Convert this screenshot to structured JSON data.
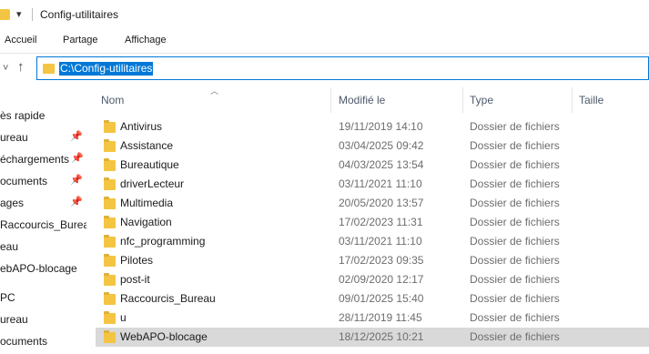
{
  "window": {
    "title": "Config-utilitaires"
  },
  "ribbon": {
    "tabs": [
      "Accueil",
      "Partage",
      "Affichage"
    ]
  },
  "address": {
    "path": "C:\\Config-utilitaires"
  },
  "sidebar": {
    "items": [
      {
        "label": "ès rapide",
        "pinned": false
      },
      {
        "label": "ureau",
        "pinned": true
      },
      {
        "label": "échargements",
        "pinned": true
      },
      {
        "label": "ocuments",
        "pinned": true
      },
      {
        "label": "ages",
        "pinned": true
      },
      {
        "label": "Raccourcis_Bureau",
        "pinned": false
      },
      {
        "label": "eau",
        "pinned": false
      },
      {
        "label": "ebAPO-blocage",
        "pinned": false
      },
      {
        "label": "PC",
        "pinned": false
      },
      {
        "label": "ureau",
        "pinned": false
      },
      {
        "label": "ocuments",
        "pinned": false
      }
    ]
  },
  "columns": {
    "name": "Nom",
    "modified": "Modifié le",
    "type": "Type",
    "size": "Taille"
  },
  "files": [
    {
      "name": "Antivirus",
      "modified": "19/11/2019 14:10",
      "type": "Dossier de fichiers"
    },
    {
      "name": "Assistance",
      "modified": "03/04/2025 09:42",
      "type": "Dossier de fichiers"
    },
    {
      "name": "Bureautique",
      "modified": "04/03/2025 13:54",
      "type": "Dossier de fichiers"
    },
    {
      "name": "driverLecteur",
      "modified": "03/11/2021 11:10",
      "type": "Dossier de fichiers"
    },
    {
      "name": "Multimedia",
      "modified": "20/05/2020 13:57",
      "type": "Dossier de fichiers"
    },
    {
      "name": "Navigation",
      "modified": "17/02/2023 11:31",
      "type": "Dossier de fichiers"
    },
    {
      "name": "nfc_programming",
      "modified": "03/11/2021 11:10",
      "type": "Dossier de fichiers"
    },
    {
      "name": "Pilotes",
      "modified": "17/02/2023 09:35",
      "type": "Dossier de fichiers"
    },
    {
      "name": "post-it",
      "modified": "02/09/2020 12:17",
      "type": "Dossier de fichiers"
    },
    {
      "name": "Raccourcis_Bureau",
      "modified": "09/01/2025 15:40",
      "type": "Dossier de fichiers"
    },
    {
      "name": "u",
      "modified": "28/11/2019 11:45",
      "type": "Dossier de fichiers"
    },
    {
      "name": "WebAPO-blocage",
      "modified": "18/12/2025 10:21",
      "type": "Dossier de fichiers",
      "selected": true
    }
  ],
  "colors": {
    "accent": "#0078d7",
    "folder": "#f4c542",
    "selected_row": "#d9d9d9"
  },
  "icons": [
    "folder-icon",
    "chevron-down-icon",
    "up-arrow-icon",
    "pin-icon",
    "sort-up-icon"
  ]
}
